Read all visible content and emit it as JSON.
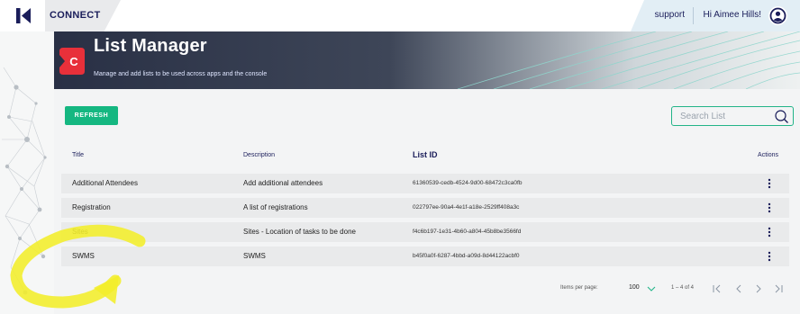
{
  "header": {
    "app_name": "CONNECT",
    "support_label": "support",
    "greeting": "Hi Aimee Hills!"
  },
  "banner": {
    "icon_letter": "C",
    "title": "List Manager",
    "subtitle": "Manage and add lists to be used across apps and the console"
  },
  "toolbar": {
    "refresh_label": "REFRESH",
    "search_placeholder": "Search List",
    "search_value": ""
  },
  "table": {
    "columns": {
      "title": "Title",
      "description": "Description",
      "list_id": "List ID",
      "actions": "Actions"
    },
    "rows": [
      {
        "title": "Additional Attendees",
        "description": "Add additional attendees",
        "list_id": "61360539-cedb-4524-9d00-68472c3ca0fb"
      },
      {
        "title": "Registration",
        "description": "A list of registrations",
        "list_id": "022797ee-90a4-4e1f-a18e-2529ff408a3c"
      },
      {
        "title": "Sites",
        "description": "Sites - Location of tasks to be done",
        "list_id": "f4c6b197-1e31-4b60-a804-45b8be3566fd"
      },
      {
        "title": "SWMS",
        "description": "SWMS",
        "list_id": "b45f0a0f-6287-4bbd-a09d-8d44122acbf0"
      }
    ]
  },
  "pagination": {
    "items_per_page_label": "Items per page:",
    "items_per_page_value": "100",
    "range_label": "1 – 4 of 4"
  },
  "colors": {
    "accent_green": "#15b781",
    "brand_navy": "#1a1d5a",
    "brand_red": "#e8303a",
    "highlight_yellow": "#f3ee2a"
  }
}
